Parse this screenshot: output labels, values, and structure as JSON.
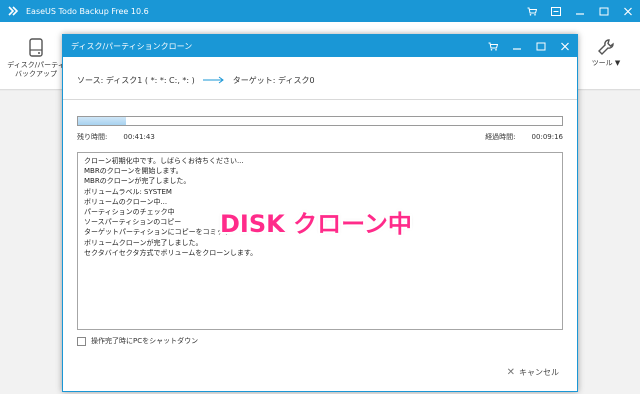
{
  "app": {
    "title": "EaseUS Todo Backup Free 10.6",
    "toolbar": {
      "backup_label_line1": "ディスク/パーティ",
      "backup_label_line2": "バックアップ",
      "tools_label": "ツール ▼"
    }
  },
  "dialog": {
    "title": "ディスク/パーティションクローン",
    "source_label": "ソース:",
    "source_value": "ディスク1 ( *: *: C:, *: )",
    "target_label": "ターゲット:",
    "target_value": "ディスク0",
    "progress_fraction": 0.1,
    "remaining_label": "残り時間:",
    "remaining_value": "00:41:43",
    "elapsed_label": "経過時間:",
    "elapsed_value": "00:09:16",
    "log_lines": [
      "クローン初期化中です。しばらくお待ちください...",
      "MBRのクローンを開始します。",
      "MBRのクローンが完了しました。",
      "ボリュームラベル: SYSTEM",
      "ボリュームのクローン中...",
      "パーティションのチェック中",
      "ソースパーティションのコピー",
      "ターゲットパーティションにコピーをコミット",
      "ボリュームクローンが完了しました。",
      "セクタバイセクタ方式でボリュームをクローンします。"
    ],
    "shutdown_label": "操作完了時にPCをシャットダウン",
    "cancel_label": "キャンセル"
  },
  "overlay": {
    "caption": "DISK クローン中"
  },
  "colors": {
    "titlebar": "#1a97d6",
    "caption": "#ff2b8a"
  }
}
